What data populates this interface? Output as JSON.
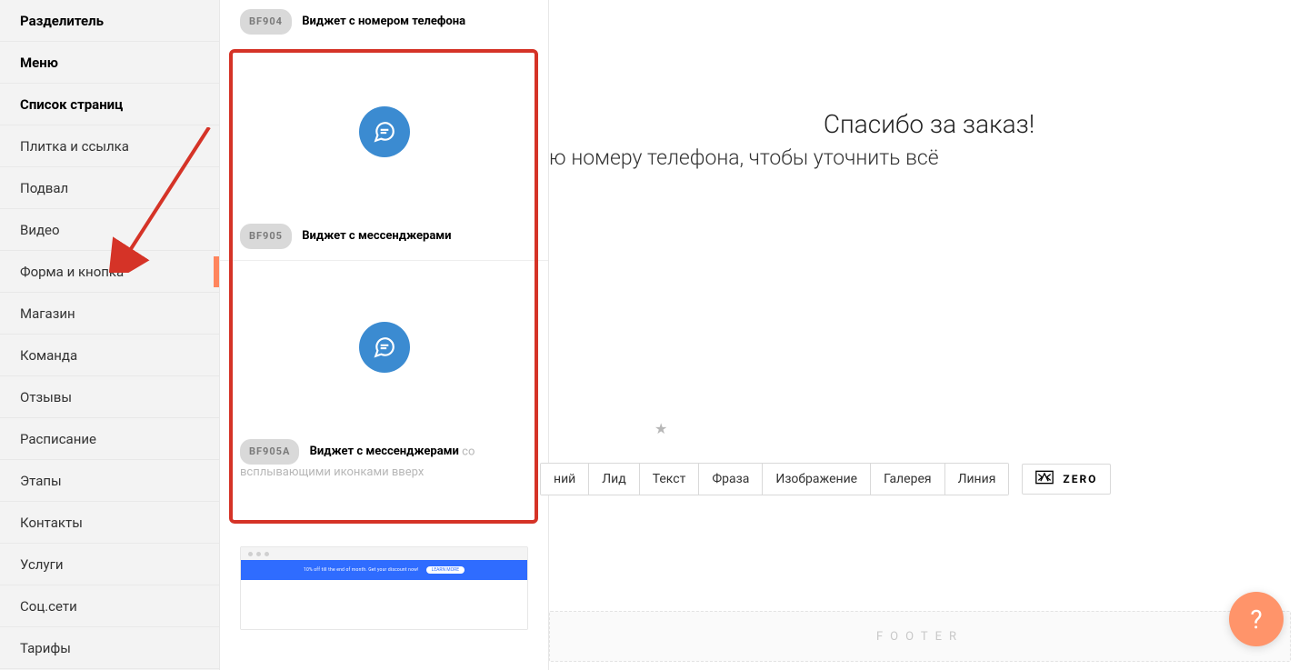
{
  "sidebar": {
    "items": [
      {
        "label": "Разделитель",
        "bold": true,
        "active": false
      },
      {
        "label": "Меню",
        "bold": true,
        "active": false
      },
      {
        "label": "Список страниц",
        "bold": true,
        "active": false
      },
      {
        "label": "Плитка и ссылка",
        "bold": false,
        "active": false
      },
      {
        "label": "Подвал",
        "bold": false,
        "active": false
      },
      {
        "label": "Видео",
        "bold": false,
        "active": false
      },
      {
        "label": "Форма и кнопка",
        "bold": false,
        "active": true
      },
      {
        "label": "Магазин",
        "bold": false,
        "active": false
      },
      {
        "label": "Команда",
        "bold": false,
        "active": false
      },
      {
        "label": "Отзывы",
        "bold": false,
        "active": false
      },
      {
        "label": "Расписание",
        "bold": false,
        "active": false
      },
      {
        "label": "Этапы",
        "bold": false,
        "active": false
      },
      {
        "label": "Контакты",
        "bold": false,
        "active": false
      },
      {
        "label": "Услуги",
        "bold": false,
        "active": false
      },
      {
        "label": "Соц.сети",
        "bold": false,
        "active": false
      },
      {
        "label": "Тарифы",
        "bold": false,
        "active": false
      }
    ]
  },
  "widgets": {
    "top": {
      "code": "BF904",
      "title": "Виджет с номером телефона"
    },
    "mid": {
      "code": "BF905",
      "title": "Виджет с мессенджерами"
    },
    "bot": {
      "code": "BF905A",
      "title": "Виджет с мессенджерами",
      "extra": "со всплывающими иконками вверх"
    },
    "banner": {
      "text": "10% off till the end of month. Get your discount now!",
      "button": "LEARN MORE"
    }
  },
  "canvas": {
    "title": "Спасибо за заказ!",
    "subtitle": "ю номеру телефона, чтобы уточнить всё",
    "footer": "FOOTER"
  },
  "toolbar": {
    "items": [
      "ний",
      "Лид",
      "Текст",
      "Фраза",
      "Изображение",
      "Галерея",
      "Линия"
    ],
    "zero": "ZERO"
  },
  "help": "?"
}
